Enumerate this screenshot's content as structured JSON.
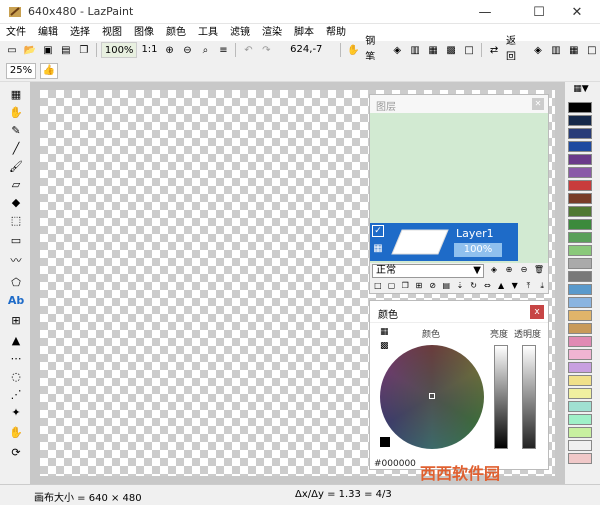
{
  "window": {
    "title": "640x480 - LazPaint"
  },
  "menu": [
    "文件",
    "编辑",
    "选择",
    "视图",
    "图像",
    "颜色",
    "工具",
    "滤镜",
    "渲染",
    "脚本",
    "帮助"
  ],
  "toolbar1": {
    "zoom_percent": "100%",
    "zoom_ratio": "1:1",
    "coords": "624,-7",
    "pen_label": "钢笔",
    "back_label": "返回"
  },
  "toolbar2": {
    "zoom_field": "25%"
  },
  "layers": {
    "title": "图层",
    "layer_name": "Layer1",
    "opacity": "100%",
    "blend_mode": "正常"
  },
  "color": {
    "title": "颜色",
    "label_color": "颜色",
    "label_luminosity": "亮度",
    "label_alpha": "透明度",
    "hex": "#000000"
  },
  "status": {
    "canvas_size": "画布大小 = 640 × 480",
    "ratio": "Δx/Δy = 1.33 = 4/3"
  },
  "palette_colors": [
    "#000000",
    "#14284a",
    "#283c78",
    "#1e4aa0",
    "#6a3a8a",
    "#8a5aa8",
    "#c83c3c",
    "#783c28",
    "#507832",
    "#3c8a3c",
    "#5aa05a",
    "#8ac87a",
    "#aaaaaa",
    "#787878",
    "#5a9acc",
    "#8ab4e0",
    "#e0b46a",
    "#c89a5a",
    "#e08ab4",
    "#f0b4d2",
    "#c8a0e0",
    "#f0e08a",
    "#f0f0a0",
    "#a0e0d2",
    "#a0f0c8",
    "#c8f0a0",
    "#f0f0f0",
    "#f0c8c8"
  ],
  "watermark": "西西软件园"
}
